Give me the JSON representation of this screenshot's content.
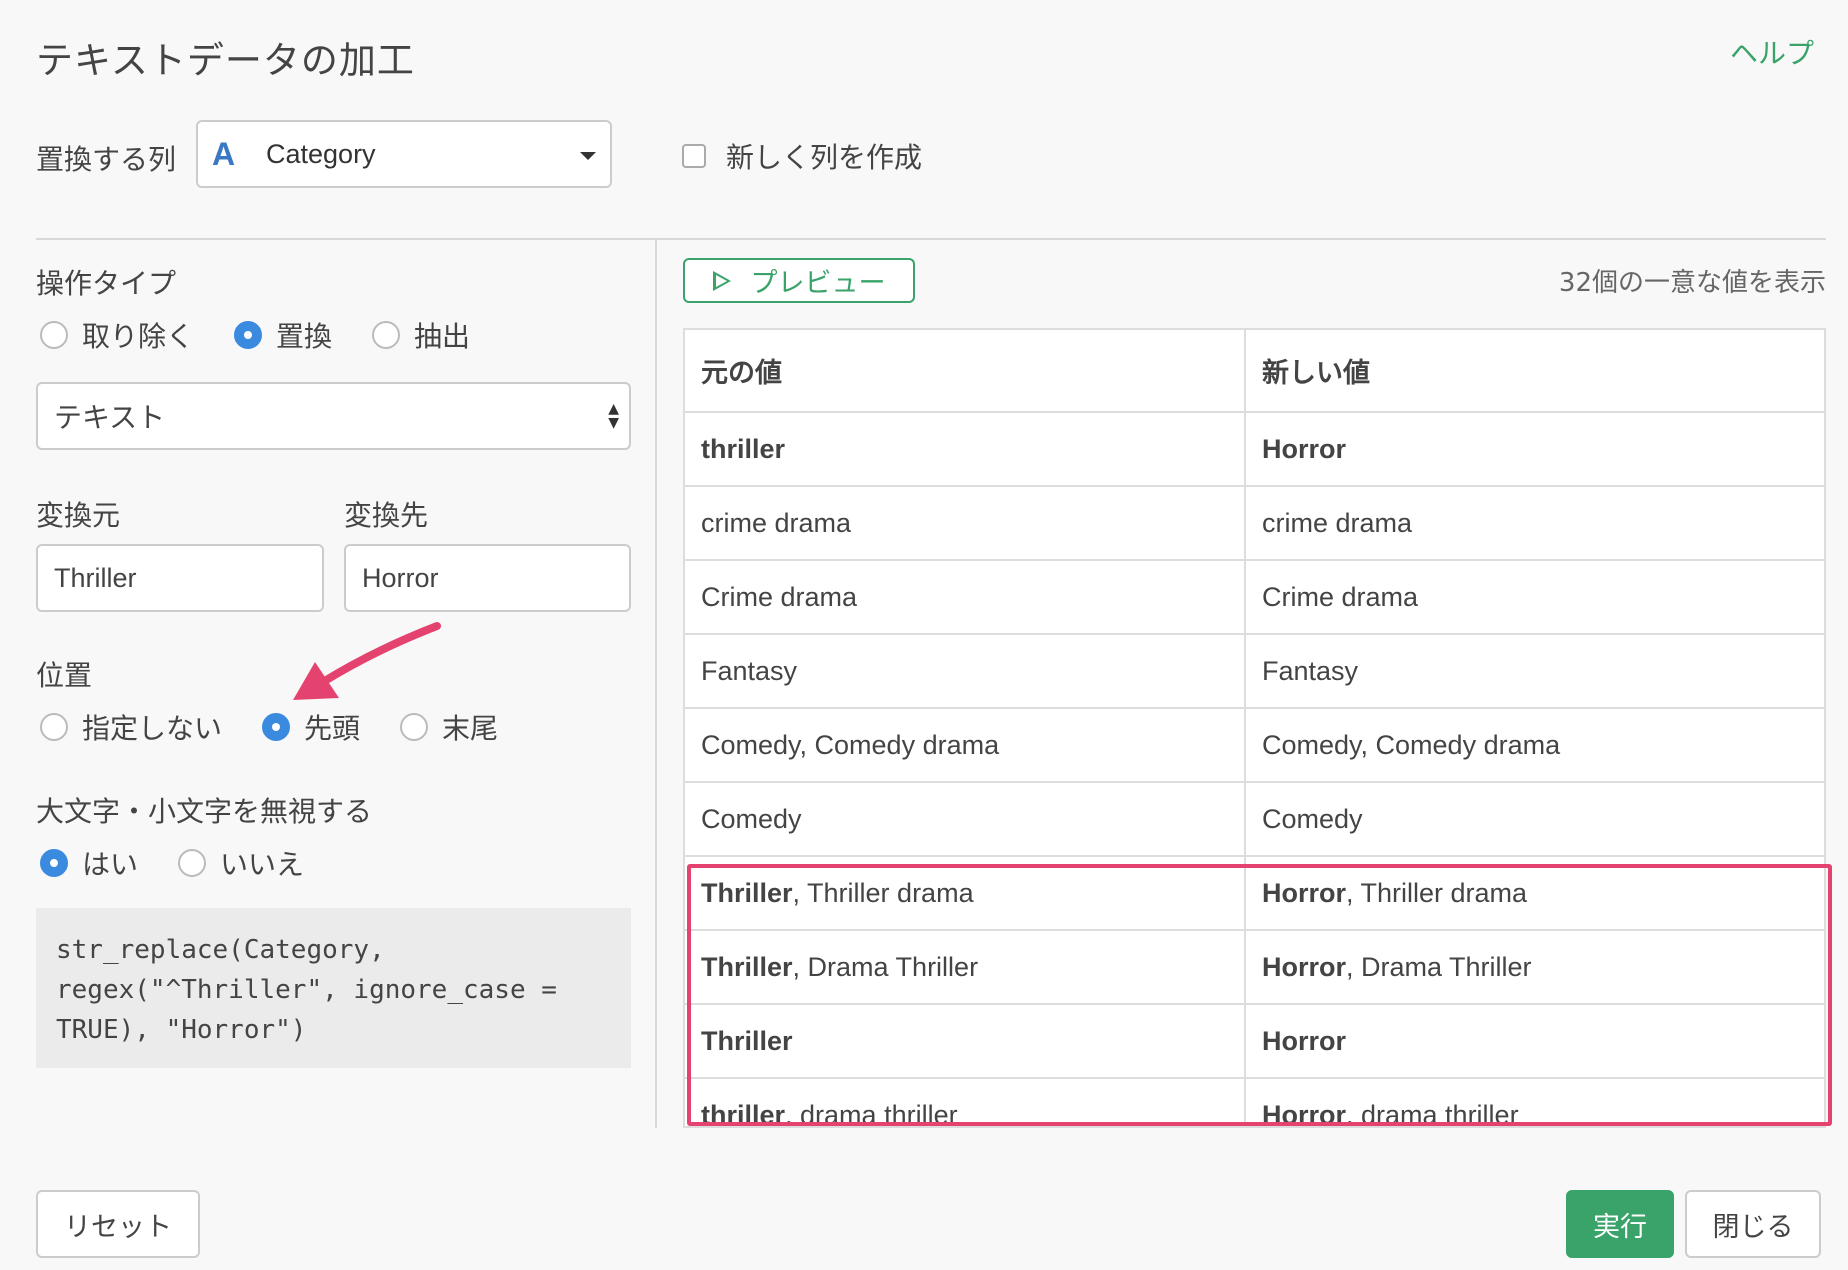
{
  "dialog": {
    "title": "テキストデータの加工",
    "help": "ヘルプ"
  },
  "column": {
    "label": "置換する列",
    "type_icon": "A",
    "value": "Category"
  },
  "new_column": {
    "label": "新しく列を作成",
    "checked": false
  },
  "op_type": {
    "label": "操作タイプ",
    "options": [
      "取り除く",
      "置換",
      "抽出"
    ],
    "selected": "置換"
  },
  "match_type": {
    "value": "テキスト"
  },
  "from": {
    "label": "変換元",
    "value": "Thriller"
  },
  "to": {
    "label": "変換先",
    "value": "Horror"
  },
  "position": {
    "label": "位置",
    "options": [
      "指定しない",
      "先頭",
      "末尾"
    ],
    "selected": "先頭"
  },
  "ignore_case": {
    "label": "大文字・小文字を無視する",
    "options": [
      "はい",
      "いいえ"
    ],
    "selected": "はい"
  },
  "code": "str_replace(Category,\nregex(\"^Thriller\", ignore_case =\nTRUE), \"Horror\")",
  "preview": {
    "button": "プレビュー",
    "unique_count": "32個の一意な値を表示"
  },
  "table": {
    "headers": [
      "元の値",
      "新しい値"
    ],
    "rows": [
      {
        "orig_bold": "thriller",
        "orig_rest": "",
        "new_bold": "Horror",
        "new_rest": ""
      },
      {
        "orig_bold": "",
        "orig_rest": "crime drama",
        "new_bold": "",
        "new_rest": "crime drama"
      },
      {
        "orig_bold": "",
        "orig_rest": "Crime drama",
        "new_bold": "",
        "new_rest": "Crime drama"
      },
      {
        "orig_bold": "",
        "orig_rest": "Fantasy",
        "new_bold": "",
        "new_rest": "Fantasy"
      },
      {
        "orig_bold": "",
        "orig_rest": "Comedy, Comedy drama",
        "new_bold": "",
        "new_rest": "Comedy, Comedy drama"
      },
      {
        "orig_bold": "",
        "orig_rest": "Comedy",
        "new_bold": "",
        "new_rest": "Comedy"
      },
      {
        "orig_bold": "Thriller",
        "orig_rest": ", Thriller drama",
        "new_bold": "Horror",
        "new_rest": ", Thriller drama"
      },
      {
        "orig_bold": "Thriller",
        "orig_rest": ", Drama Thriller",
        "new_bold": "Horror",
        "new_rest": ", Drama Thriller"
      },
      {
        "orig_bold": "Thriller",
        "orig_rest": "",
        "new_bold": "Horror",
        "new_rest": ""
      },
      {
        "orig_bold": "thriller",
        "orig_rest": ", drama thriller",
        "new_bold": "Horror",
        "new_rest": ", drama thriller"
      }
    ]
  },
  "footer": {
    "reset": "リセット",
    "run": "実行",
    "close": "閉じる"
  },
  "colors": {
    "accent": "#3aa36a",
    "radio": "#3a8be0",
    "highlight": "#e5436f"
  }
}
